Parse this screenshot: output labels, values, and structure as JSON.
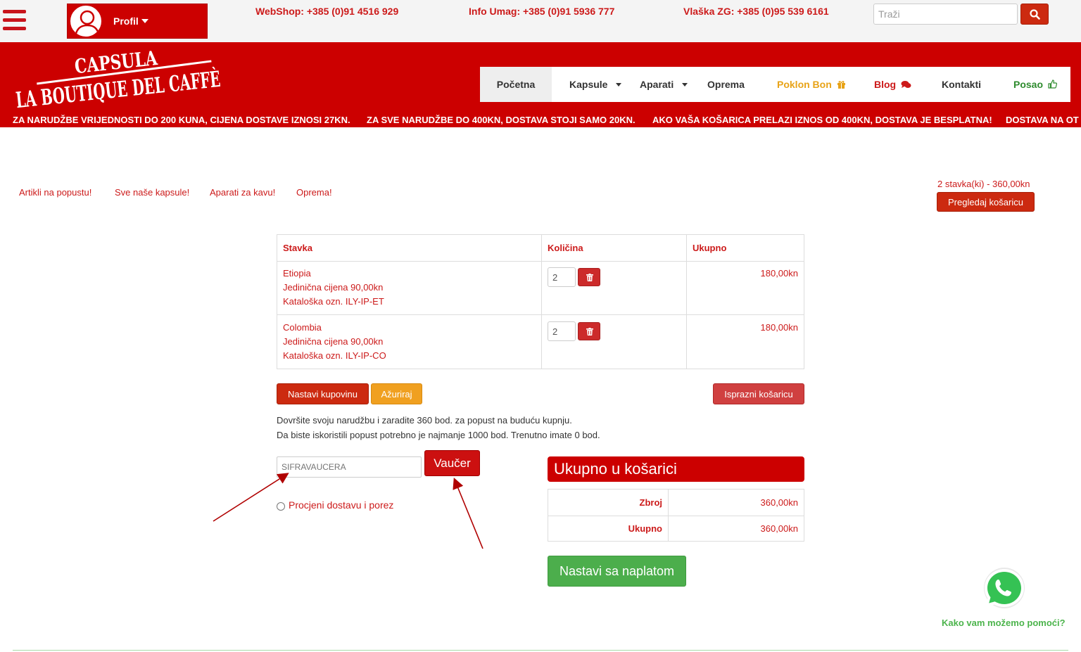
{
  "topbar": {
    "profile_label": "Profil",
    "contacts": [
      "WebShop: +385 (0)91 4516 929",
      "Info Umag: +385 (0)91 5936 777",
      "Vlaška ZG: +385 (0)95 539 6161"
    ],
    "search_placeholder": "Traži"
  },
  "brand": {
    "line1": "CAPSULA",
    "line2": "LA BOUTIQUE DEL CAFFÈ"
  },
  "nav": {
    "items": [
      "Početna",
      "Kapsule",
      "Aparati",
      "Oprema",
      "Poklon Bon",
      "Blog",
      "Kontakti",
      "Posao"
    ]
  },
  "ticker": [
    "ZA NARUDŽBE VRIJEDNOSTI DO 200 KUNA, CIJENA DOSTAVE IZNOSI 27KN.",
    "ZA SVE NARUDŽBE DO 400KN, DOSTAVA STOJI SAMO 20KN.",
    "AKO VAŠA KOŠARICA PRELAZI IZNOS OD 400KN, DOSTAVA JE BESPLATNA!",
    "DOSTAVA NA OT"
  ],
  "quick_links": [
    "Artikli na popustu!",
    "Sve naše kapsule!",
    "Aparati za kavu!",
    "Oprema!"
  ],
  "cart_summary": {
    "text": "2 stavka(ki) - 360,00kn",
    "button": "Pregledaj košaricu"
  },
  "cart": {
    "headers": [
      "Stavka",
      "Količina",
      "Ukupno"
    ],
    "rows": [
      {
        "name": "Etiopia",
        "unit_price": "Jedinična cijena 90,00kn",
        "sku": "Kataloška ozn. ILY-IP-ET",
        "qty": "2",
        "total": "180,00kn"
      },
      {
        "name": "Colombia",
        "unit_price": "Jedinična cijena 90,00kn",
        "sku": "Kataloška ozn. ILY-IP-CO",
        "qty": "2",
        "total": "180,00kn"
      }
    ]
  },
  "actions": {
    "continue_shopping": "Nastavi kupovinu",
    "update": "Ažuriraj",
    "empty_cart": "Isprazni košaricu"
  },
  "points_info": [
    "Dovršite svoju narudžbu i zaradite 360 bod. za popust na buduću kupnju.",
    "Da biste iskoristili popust potrebno je najmanje 1000 bod. Trenutno imate 0 bod."
  ],
  "voucher": {
    "placeholder": "SIFRAVAUCERA",
    "button": "Vaučer"
  },
  "shipping_estimate": "Procjeni dostavu i porez",
  "totals": {
    "title": "Ukupno u košarici",
    "rows": [
      {
        "label": "Zbroj",
        "value": "360,00kn"
      },
      {
        "label": "Ukupno",
        "value": "360,00kn"
      }
    ],
    "checkout": "Nastavi sa naplatom"
  },
  "whatsapp": {
    "text": "Kako vam možemo pomoći?"
  },
  "colors": {
    "brand_red": "#cc0000",
    "update_orange": "#f0a020",
    "checkout_green": "#4cae4c",
    "poklon_gold": "#e8a317",
    "posao_green": "#2e8b2e"
  }
}
